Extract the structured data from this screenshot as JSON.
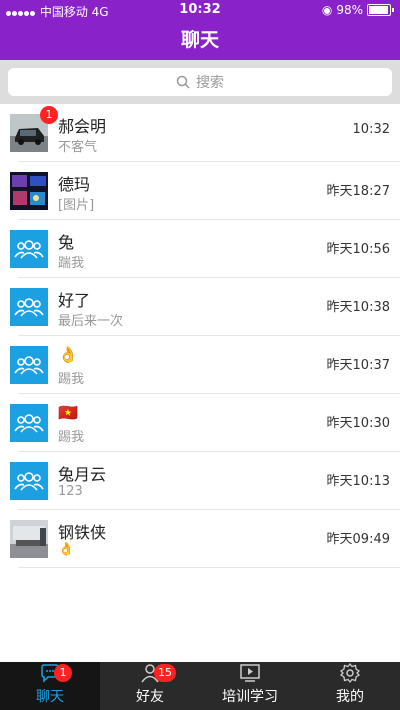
{
  "status": {
    "carrier": "中国移动",
    "network": "4G",
    "time": "10:32",
    "battery": "98%"
  },
  "nav": {
    "title": "聊天"
  },
  "search": {
    "placeholder": "搜索"
  },
  "chats": [
    {
      "name": "郝会明",
      "message": "不客气",
      "time": "10:32",
      "badge": "1",
      "avatar": "car-photo"
    },
    {
      "name": "德玛",
      "message": "[图片]",
      "time": "昨天18:27",
      "avatar": "event-photo"
    },
    {
      "name": "兔",
      "message": "踹我",
      "time": "昨天10:56",
      "avatar": "group"
    },
    {
      "name": "好了",
      "message": "最后来一次",
      "time": "昨天10:38",
      "avatar": "group"
    },
    {
      "name": "👌",
      "message": "踢我",
      "time": "昨天10:37",
      "avatar": "group"
    },
    {
      "name": "🇻🇳",
      "message": "踢我",
      "time": "昨天10:30",
      "avatar": "group"
    },
    {
      "name": "兔月云",
      "message": "123",
      "time": "昨天10:13",
      "avatar": "group"
    },
    {
      "name": "钢铁侠",
      "message": "👌",
      "time": "昨天09:49",
      "avatar": "room-photo"
    }
  ],
  "tabs": [
    {
      "label": "聊天",
      "badge": "1",
      "icon": "chat-icon"
    },
    {
      "label": "好友",
      "badge": "15",
      "icon": "contacts-icon"
    },
    {
      "label": "培训学习",
      "icon": "video-icon"
    },
    {
      "label": "我的",
      "icon": "gear-icon"
    }
  ],
  "colors": {
    "nav": "#8a22c9",
    "group_avatar": "#1ba1e2",
    "badge": "#ff2222",
    "tabbar": "#2a2a2a",
    "tab_active": "#1ba1e2"
  }
}
